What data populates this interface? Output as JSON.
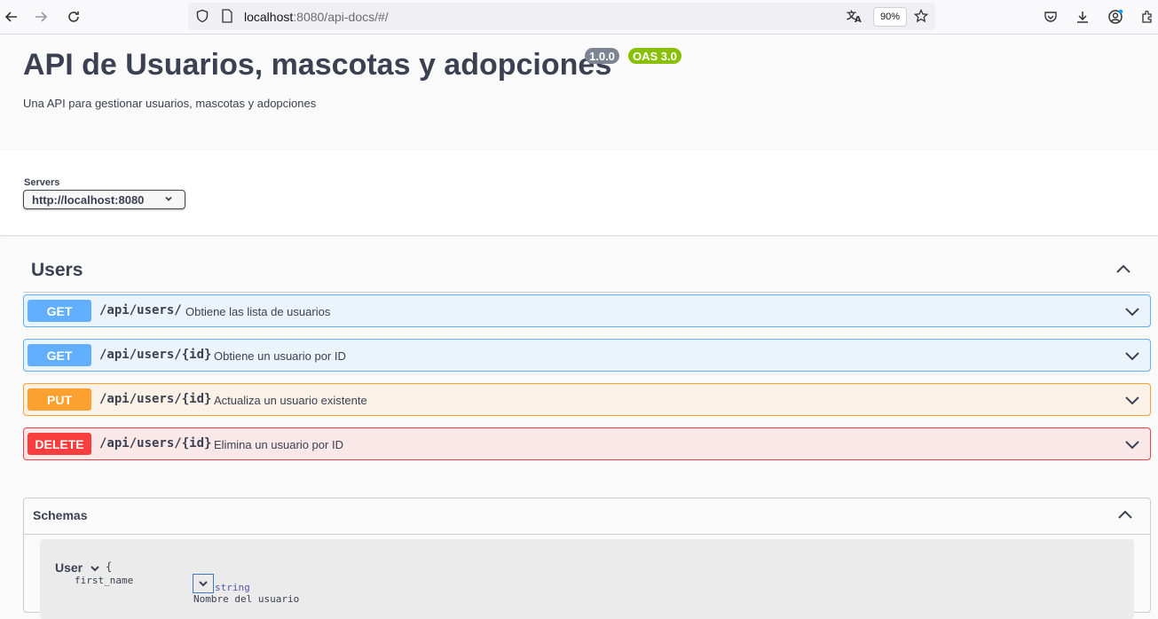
{
  "browser": {
    "url_host": "localhost",
    "url_rest": ":8080/api-docs/#/",
    "zoom": "90%",
    "icons": [
      "back-icon",
      "forward-icon",
      "reload-icon",
      "shield-icon",
      "page-icon",
      "translate-icon",
      "star-icon",
      "pocket-icon",
      "download-icon",
      "account-icon",
      "extensions-icon"
    ]
  },
  "info": {
    "title": "API de Usuarios, mascotas y adopciones",
    "version": "1.0.0",
    "oas": "OAS 3.0",
    "description": "Una API para gestionar usuarios, mascotas y adopciones"
  },
  "servers": {
    "label": "Servers",
    "selected": "http://localhost:8080"
  },
  "tag": {
    "name": "Users",
    "operations": [
      {
        "method": "GET",
        "path": "/api/users/",
        "summary": "Obtiene las lista de usuarios"
      },
      {
        "method": "GET",
        "path": "/api/users/{id}",
        "summary": "Obtiene un usuario por ID"
      },
      {
        "method": "PUT",
        "path": "/api/users/{id}",
        "summary": "Actualiza un usuario existente"
      },
      {
        "method": "DELETE",
        "path": "/api/users/{id}",
        "summary": "Elimina un usuario por ID"
      }
    ]
  },
  "schemas": {
    "title": "Schemas",
    "model": {
      "name": "User",
      "brace": "{",
      "property": {
        "name": "first_name",
        "type": "string",
        "description": "Nombre del usuario"
      }
    }
  },
  "colors": {
    "get": "#61affe",
    "put": "#fca130",
    "delete": "#f93e3e",
    "version_badge": "#7d8492",
    "oas_badge": "#89bf04"
  }
}
